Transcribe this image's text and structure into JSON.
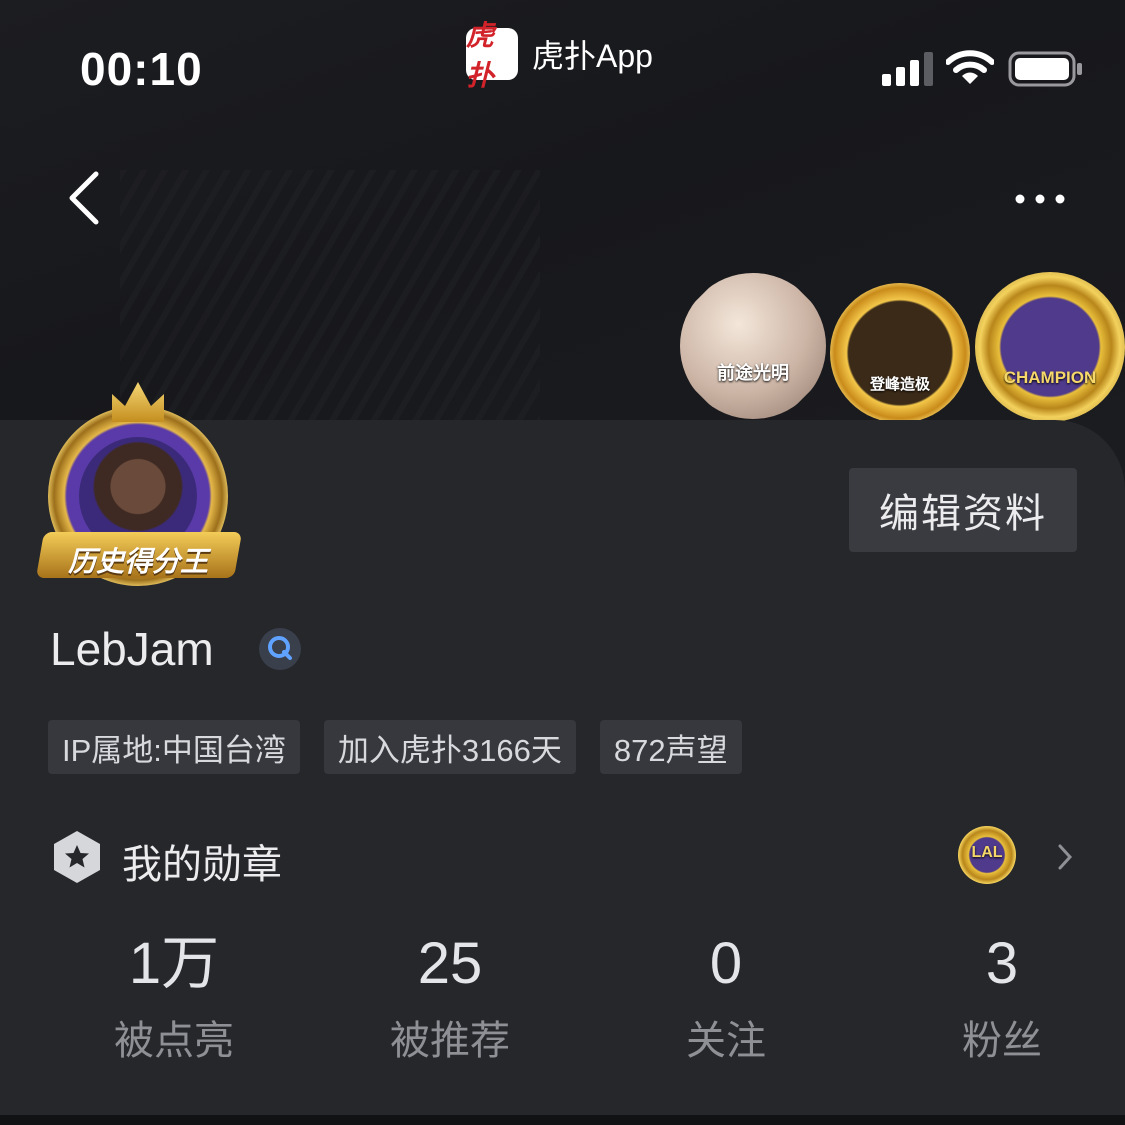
{
  "status_bar": {
    "time": "00:10",
    "app_logo_text": "虎扑",
    "app_name": "虎扑App"
  },
  "badges": [
    {
      "text": "前途光明"
    },
    {
      "text": "登峰造极"
    },
    {
      "text": "CHAMPION"
    }
  ],
  "profile": {
    "avatar_ribbon": "历史得分王",
    "edit_button": "编辑资料",
    "username": "LebJam",
    "tags": [
      "IP属地:中国台湾",
      "加入虎扑3166天",
      "872声望"
    ]
  },
  "medals": {
    "label": "我的勋章",
    "mini_badge_text": "LAL"
  },
  "stats": [
    {
      "value": "1万",
      "label": "被点亮"
    },
    {
      "value": "25",
      "label": "被推荐"
    },
    {
      "value": "0",
      "label": "关注"
    },
    {
      "value": "3",
      "label": "粉丝"
    }
  ]
}
